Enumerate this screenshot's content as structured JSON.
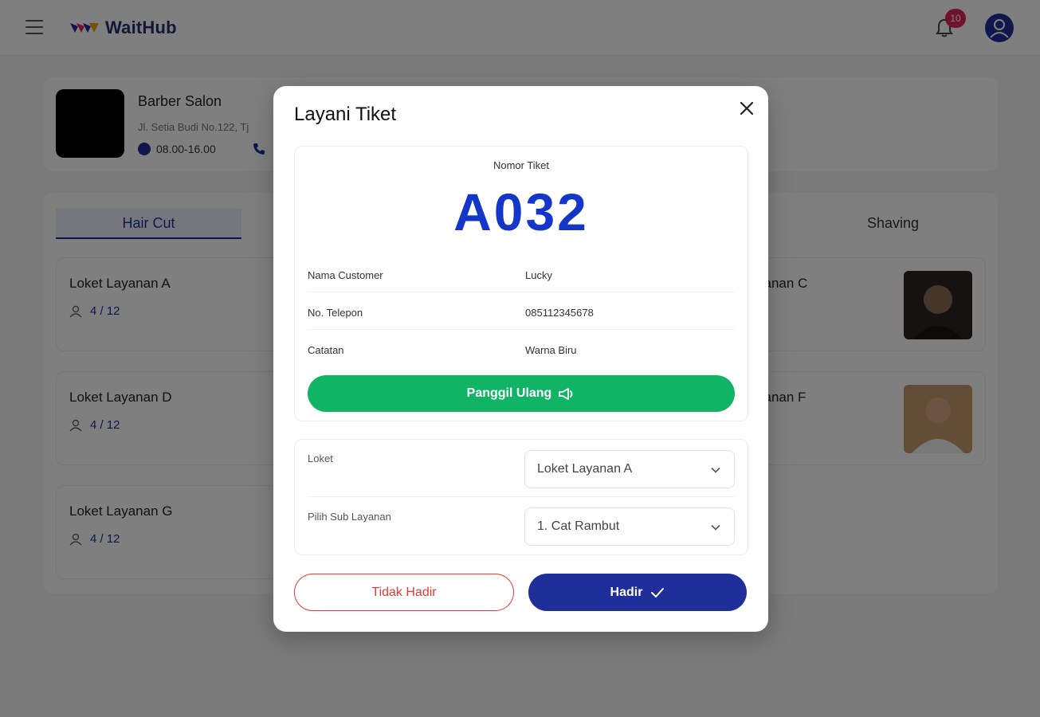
{
  "header": {
    "app_name": "WaitHub",
    "notification_count": "10"
  },
  "shop": {
    "name": "Barber Salon",
    "address": "Jl. Setia Budi No.122, Tj",
    "hours": "08.00-16.00"
  },
  "tabs": [
    {
      "label": "Hair Cut",
      "active": true
    },
    {
      "label": "Shaving",
      "active": false
    }
  ],
  "counters_left": [
    {
      "name": "Loket Layanan A",
      "queue": "4 / 12"
    },
    {
      "name": "Loket Layanan D",
      "queue": "4 / 12"
    },
    {
      "name": "Loket Layanan G",
      "queue": "4 / 12"
    }
  ],
  "counters_right": [
    {
      "name_partial": "yanan C"
    },
    {
      "name_partial": "yanan F"
    }
  ],
  "modal": {
    "title": "Layani Tiket",
    "ticket_label": "Nomor Tiket",
    "ticket_number": "A032",
    "info": [
      {
        "key": "Nama Customer",
        "value": "Lucky"
      },
      {
        "key": "No. Telepon",
        "value": "085112345678"
      },
      {
        "key": "Catatan",
        "value": "Warna Biru"
      }
    ],
    "recall_label": "Panggil Ulang",
    "counter_label": "Loket",
    "counter_value": "Loket Layanan A",
    "subservice_label": "Pilih Sub Layanan",
    "subservice_value": "1. Cat Rambut",
    "absent_label": "Tidak Hadir",
    "present_label": "Hadir"
  },
  "colors": {
    "primary": "#1f2f9a",
    "ticket_blue": "#1437c9",
    "green": "#10b464",
    "red": "#e53935",
    "badge": "#e0245e"
  }
}
